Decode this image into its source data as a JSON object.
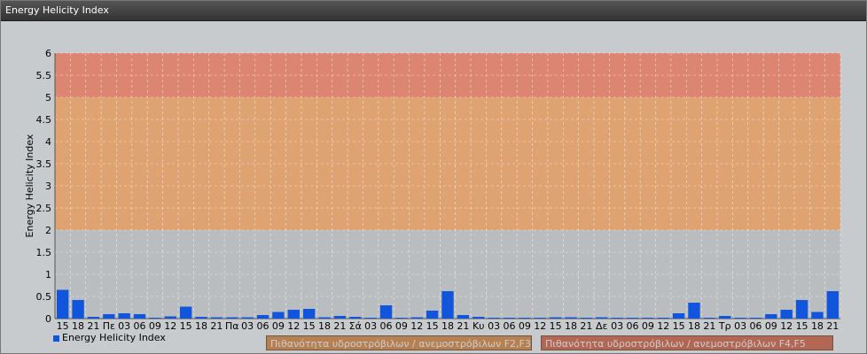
{
  "window": {
    "title": "Energy Helicity Index"
  },
  "legend": {
    "series_label": "Energy Helicity Index"
  },
  "zones": [
    {
      "label": "Πιθανότητα υδροστρόβιλων / ανεμοστρόβιλων F2,F3",
      "from": 2,
      "to": 5,
      "color": "#e3a068"
    },
    {
      "label": "Πιθανότητα υδροστρόβιλων / ανεμοστρόβιλων F4,F5",
      "from": 5,
      "to": 6,
      "color": "#e07f68"
    }
  ],
  "chart_data": {
    "type": "bar",
    "title": "",
    "ylabel": "Energy Helicity Index",
    "ylim": [
      0,
      6
    ],
    "yticks": [
      "0",
      "0.5",
      "1",
      "1.5",
      "2",
      "2.5",
      "3",
      "3.5",
      "4",
      "4.5",
      "5",
      "5.5",
      "6"
    ],
    "grid": true,
    "categories": [
      "15",
      "18",
      "21",
      "Πε",
      "03",
      "06",
      "09",
      "12",
      "15",
      "18",
      "21",
      "Πα",
      "03",
      "06",
      "09",
      "12",
      "15",
      "18",
      "21",
      "Σά",
      "03",
      "06",
      "09",
      "12",
      "15",
      "18",
      "21",
      "Κυ",
      "03",
      "06",
      "09",
      "12",
      "15",
      "18",
      "21",
      "Δε",
      "03",
      "06",
      "09",
      "12",
      "15",
      "18",
      "21",
      "Τρ",
      "03",
      "06",
      "09",
      "12",
      "15",
      "18",
      "21"
    ],
    "series": [
      {
        "name": "Energy Helicity Index",
        "color": "#1155dd",
        "values": [
          0.65,
          0.42,
          0.04,
          0.1,
          0.12,
          0.1,
          0.02,
          0.05,
          0.27,
          0.04,
          0.03,
          0.03,
          0.03,
          0.08,
          0.15,
          0.2,
          0.22,
          0.03,
          0.06,
          0.04,
          0.02,
          0.3,
          0.02,
          0.03,
          0.18,
          0.62,
          0.08,
          0.04,
          0.02,
          0.02,
          0.02,
          0.02,
          0.03,
          0.03,
          0.02,
          0.03,
          0.02,
          0.02,
          0.02,
          0.02,
          0.12,
          0.36,
          0.02,
          0.06,
          0.02,
          0.02,
          0.1,
          0.2,
          0.42,
          0.15,
          0.62
        ]
      }
    ]
  }
}
